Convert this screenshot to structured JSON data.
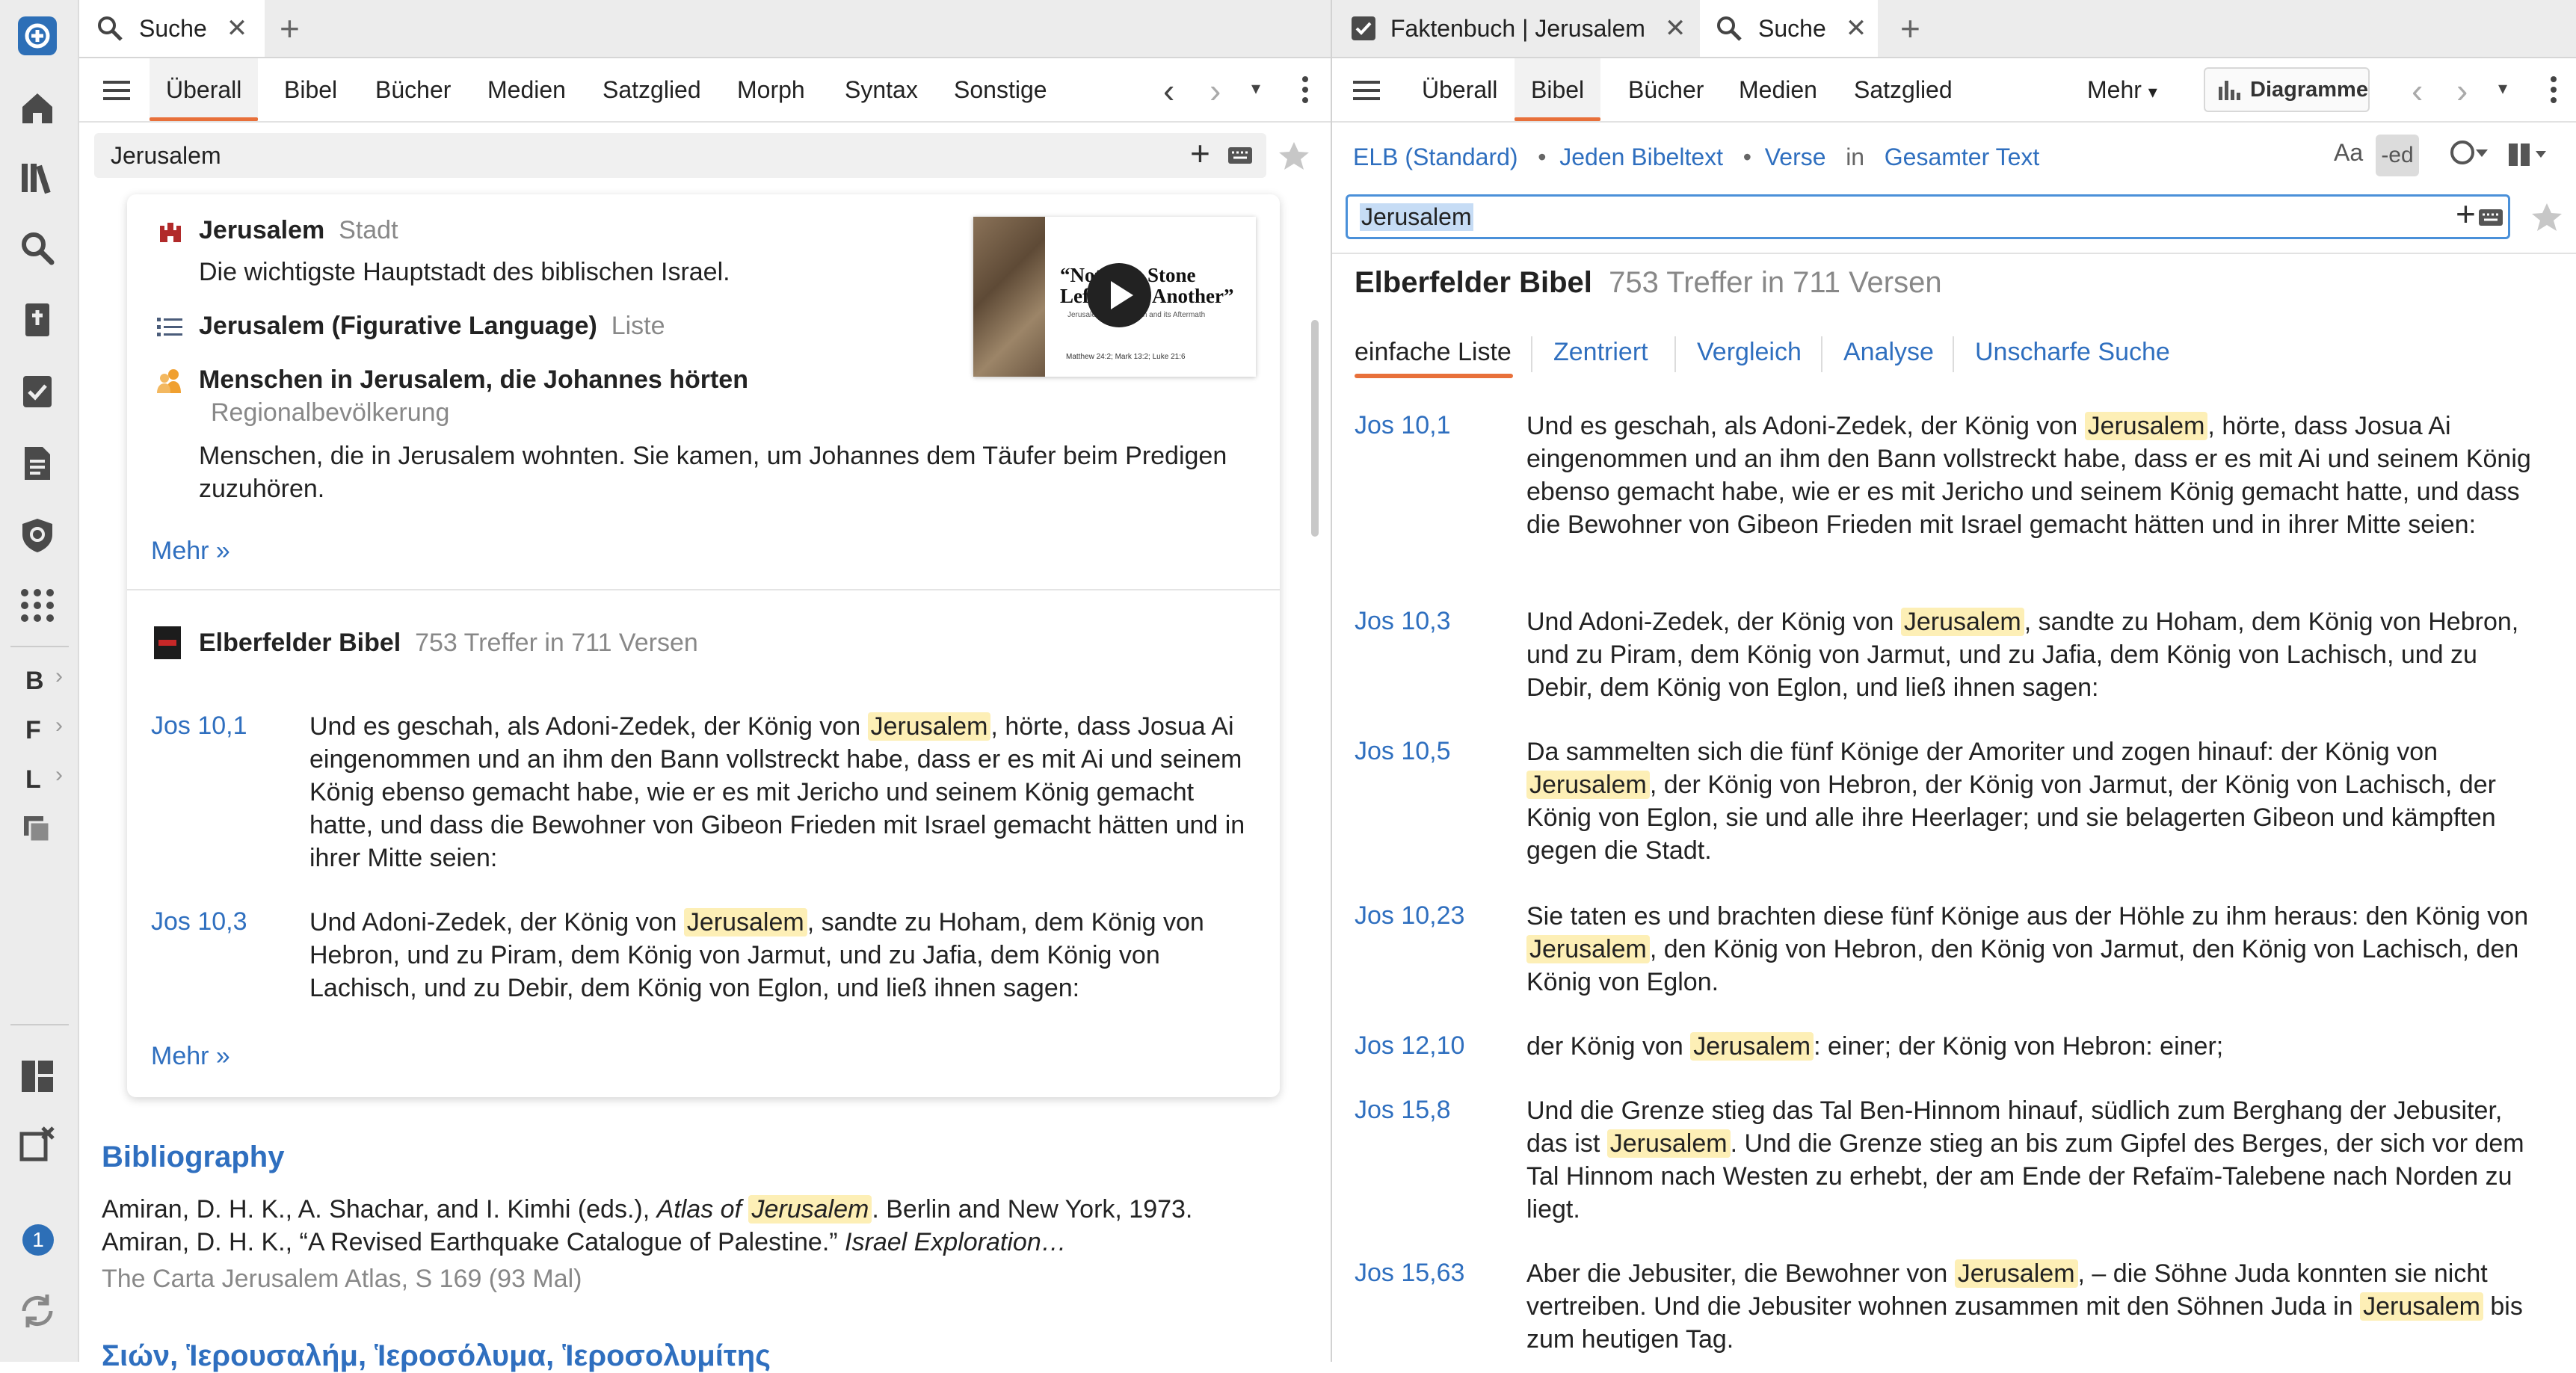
{
  "left": {
    "tab": {
      "label": "Suche"
    },
    "nav": [
      "Überall",
      "Bibel",
      "Bücher",
      "Medien",
      "Satzglied",
      "Morph",
      "Syntax",
      "Sonstige"
    ],
    "search": {
      "value": "Jerusalem"
    },
    "results": {
      "r1": {
        "title": "Jerusalem",
        "type": "Stadt",
        "desc": "Die wichtigste Hauptstadt des biblischen Israel."
      },
      "r2": {
        "title": "Jerusalem (Figurative Language)",
        "type": "Liste"
      },
      "r3": {
        "title": "Menschen in Jerusalem, die Johannes hörten",
        "type": "Regionalbevölkerung",
        "desc": "Menschen, die in Jerusalem wohnten. Sie kamen, um Johannes dem Täufer beim Predigen zuzuhören."
      }
    },
    "video": {
      "line1": "“Not One Stone",
      "line2": "Left Upon Another”",
      "sub": "Jerusalem's Destruction and its Aftermath",
      "refs": "Matthew 24:2; Mark 13:2; Luke 21:6"
    },
    "more1": "Mehr »",
    "bible": {
      "name": "Elberfelder Bibel",
      "count": "753 Treffer in 711 Versen"
    },
    "verses": [
      {
        "ref": "Jos 10,1",
        "pre": "Und es geschah, als Adoni-Zedek, der König von ",
        "hit": "Jerusalem",
        "post": ", hörte, dass Josua Ai eingenommen und an ihm den Bann vollstreckt habe, dass er es mit Ai und seinem König ebenso gemacht habe, wie er es mit Jericho und seinem König gemacht hatte, und dass die Bewohner von Gibeon Frieden mit Israel gemacht hätten und in ihrer Mitte seien:"
      },
      {
        "ref": "Jos 10,3",
        "pre": "Und Adoni-Zedek, der König von ",
        "hit": "Jerusalem",
        "post": ", sandte zu Hoham, dem König von Hebron, und zu Piram, dem König von Jarmut, und zu Jafia, dem König von Lachisch, und zu Debir, dem König von Eglon, und ließ ihnen sagen:"
      }
    ],
    "more2": "Mehr »",
    "biblio": {
      "heading": "Bibliography",
      "line_a": "Amiran, D. H. K., A. Shachar, and I. Kimhi (eds.), ",
      "line_a_italic": "Atlas of ",
      "line_a_hit": "Jerusalem",
      "line_a_post": ". Berlin and New York, 1973. Amiran, D. H. K., “A Revised Earthquake Catalogue of Palestine.” ",
      "line_a_italic2": "Israel Exploration…",
      "source": "The Carta Jerusalem Atlas, S 169 (93 Mal)",
      "next_heading": "Σιών, Ἱερουσαλήμ, Ἱεροσόλυμα, Ἱεροσολυμίτης"
    }
  },
  "right": {
    "tab1": {
      "label": "Faktenbuch | Jerusalem"
    },
    "tab2": {
      "label": "Suche"
    },
    "nav": [
      "Überall",
      "Bibel",
      "Bücher",
      "Medien",
      "Satzglied"
    ],
    "more": "Mehr",
    "charts": "Diagramme",
    "filter": {
      "version": "ELB (Standard)",
      "scope": "Jeden Bibeltext",
      "unit": "Verse",
      "in": "in",
      "range": "Gesamter Text"
    },
    "search": {
      "value": "Jerusalem"
    },
    "header": {
      "name": "Elberfelder Bibel",
      "count": "753 Treffer in 711 Versen"
    },
    "views": [
      "einfache Liste",
      "Zentriert",
      "Vergleich",
      "Analyse",
      "Unscharfe Suche"
    ],
    "verses": [
      {
        "ref": "Jos 10,1",
        "pre": "Und es geschah, als Adoni-Zedek, der König von ",
        "hit": "Jerusalem",
        "post": ", hörte, dass Josua Ai eingenommen und an ihm den Bann vollstreckt habe, dass er es mit Ai und seinem König ebenso gemacht habe, wie er es mit Jericho und seinem König gemacht hatte, und dass die Bewohner von Gibeon Frieden mit Israel gemacht hätten und in ihrer Mitte seien:"
      },
      {
        "ref": "Jos 10,3",
        "pre": "Und Adoni-Zedek, der König von ",
        "hit": "Jerusalem",
        "post": ", sandte zu Hoham, dem König von Hebron, und zu Piram, dem König von Jarmut, und zu Jafia, dem König von Lachisch, und zu Debir, dem König von Eglon, und ließ ihnen sagen:"
      },
      {
        "ref": "Jos 10,5",
        "pre": "Da sammelten sich die fünf Könige der Amoriter und zogen hinauf: der König von ",
        "hit": "Jerusalem",
        "post": ", der König von Hebron, der König von Jarmut, der König von Lachisch, der König von Eglon, sie und alle ihre Heerlager; und sie belagerten Gibeon und kämpften gegen die Stadt."
      },
      {
        "ref": "Jos 10,23",
        "pre": "Sie taten es und brachten diese fünf Könige aus der Höhle zu ihm heraus: den König von ",
        "hit": "Jerusalem",
        "post": ", den König von Hebron, den König von Jarmut, den König von Lachisch, den König von Eglon."
      },
      {
        "ref": "Jos 12,10",
        "pre": "der König von ",
        "hit": "Jerusalem",
        "post": ": einer; der König von Hebron: einer;"
      },
      {
        "ref": "Jos 15,8",
        "pre": "Und die Grenze stieg das Tal Ben-Hinnom hinauf, südlich zum Berghang der Jebusiter, das ist ",
        "hit": "Jerusalem",
        "post": ". Und die Grenze stieg an bis zum Gipfel des Berges, der sich vor dem Tal Hinnom nach Westen zu erhebt, der am Ende der Refaïm-Talebene nach Norden zu liegt."
      },
      {
        "ref": "Jos 15,63",
        "pre": "Aber die Jebusiter, die Bewohner von ",
        "hit": "Jerusalem",
        "mid": ", – die Söhne Juda konnten sie nicht vertreiben. Und die Jebusiter wohnen zusammen mit den Söhnen Juda in ",
        "hit2": "Jerusalem",
        "post": " bis zum heutigen Tag."
      }
    ]
  },
  "sidebar": {
    "letters": [
      "B",
      "F",
      "L"
    ],
    "badge": "1"
  }
}
